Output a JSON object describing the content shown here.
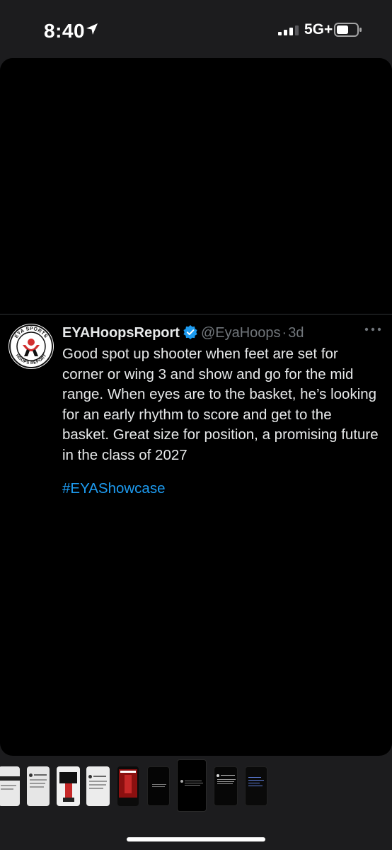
{
  "status_bar": {
    "time": "8:40",
    "network": "5G+"
  },
  "tweet": {
    "display_name": "EYAHoopsReport",
    "handle": "@EyaHoops",
    "separator": "·",
    "time_ago": "3d",
    "text": "Good spot up shooter when feet are set for corner or wing 3 and show and go for the mid range. When eyes are to the basket, he’s looking for an early rhythm to score and get to the basket. Great size for position, a promising future in the class of 2027",
    "hashtag": "#EYAShowcase"
  },
  "avatar_logo": {
    "top_text": "EYA SPORTS",
    "bottom_text": "HOOPS REPORT"
  },
  "thumbnail_strip": {
    "selected_index": 6
  },
  "colors": {
    "background": "#1c1c1e",
    "viewer": "#000000",
    "text": "#e7e9ea",
    "muted": "#71767b",
    "link": "#1d9bf0",
    "verified": "#1d9bf0"
  }
}
